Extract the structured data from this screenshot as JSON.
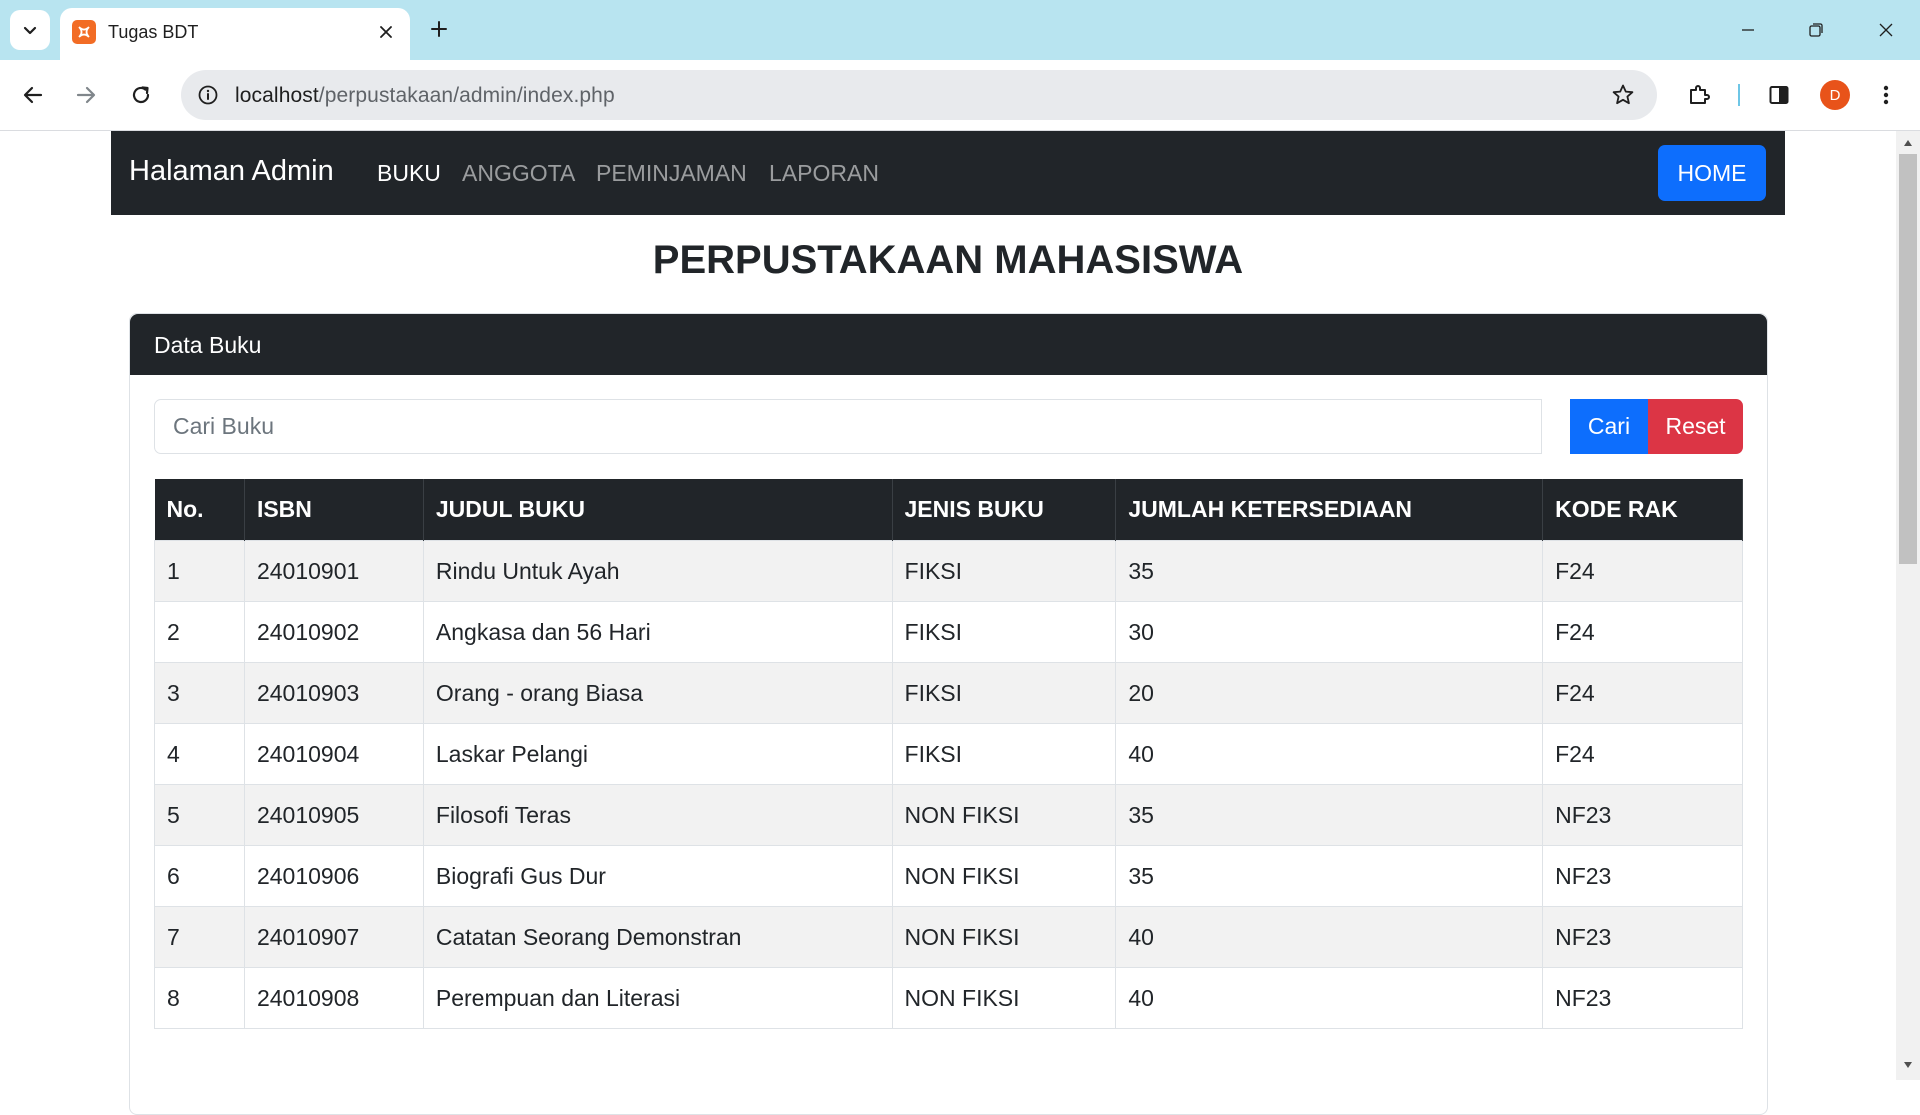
{
  "browser": {
    "tab_title": "Tugas BDT",
    "url_host": "localhost",
    "url_path": "/perpustakaan/admin/index.php",
    "profile_initial": "D"
  },
  "navbar": {
    "brand": "Halaman Admin",
    "links": [
      "BUKU",
      "ANGGOTA",
      "PEMINJAMAN",
      "LAPORAN"
    ],
    "active_link": "BUKU",
    "home_label": "HOME"
  },
  "page": {
    "title": "PERPUSTAKAAN MAHASISWA"
  },
  "card": {
    "header": "Data Buku",
    "search_placeholder": "Cari Buku",
    "search_value": "",
    "search_button": "Cari",
    "reset_button": "Reset"
  },
  "table": {
    "columns": [
      "No.",
      "ISBN",
      "JUDUL BUKU",
      "JENIS BUKU",
      "JUMLAH KETERSEDIAAN",
      "KODE RAK"
    ],
    "rows": [
      [
        "1",
        "24010901",
        "Rindu Untuk Ayah",
        "FIKSI",
        "35",
        "F24"
      ],
      [
        "2",
        "24010902",
        "Angkasa dan 56 Hari",
        "FIKSI",
        "30",
        "F24"
      ],
      [
        "3",
        "24010903",
        "Orang - orang Biasa",
        "FIKSI",
        "20",
        "F24"
      ],
      [
        "4",
        "24010904",
        "Laskar Pelangi",
        "FIKSI",
        "40",
        "F24"
      ],
      [
        "5",
        "24010905",
        "Filosofi Teras",
        "NON FIKSI",
        "35",
        "NF23"
      ],
      [
        "6",
        "24010906",
        "Biografi Gus Dur",
        "NON FIKSI",
        "35",
        "NF23"
      ],
      [
        "7",
        "24010907",
        "Catatan Seorang Demonstran",
        "NON FIKSI",
        "40",
        "NF23"
      ],
      [
        "8",
        "24010908",
        "Perempuan dan Literasi",
        "NON FIKSI",
        "40",
        "NF23"
      ]
    ]
  },
  "colors": {
    "dark": "#212529",
    "primary": "#0d6efd",
    "danger": "#dc3545",
    "tabstrip": "#b8e4f0"
  }
}
